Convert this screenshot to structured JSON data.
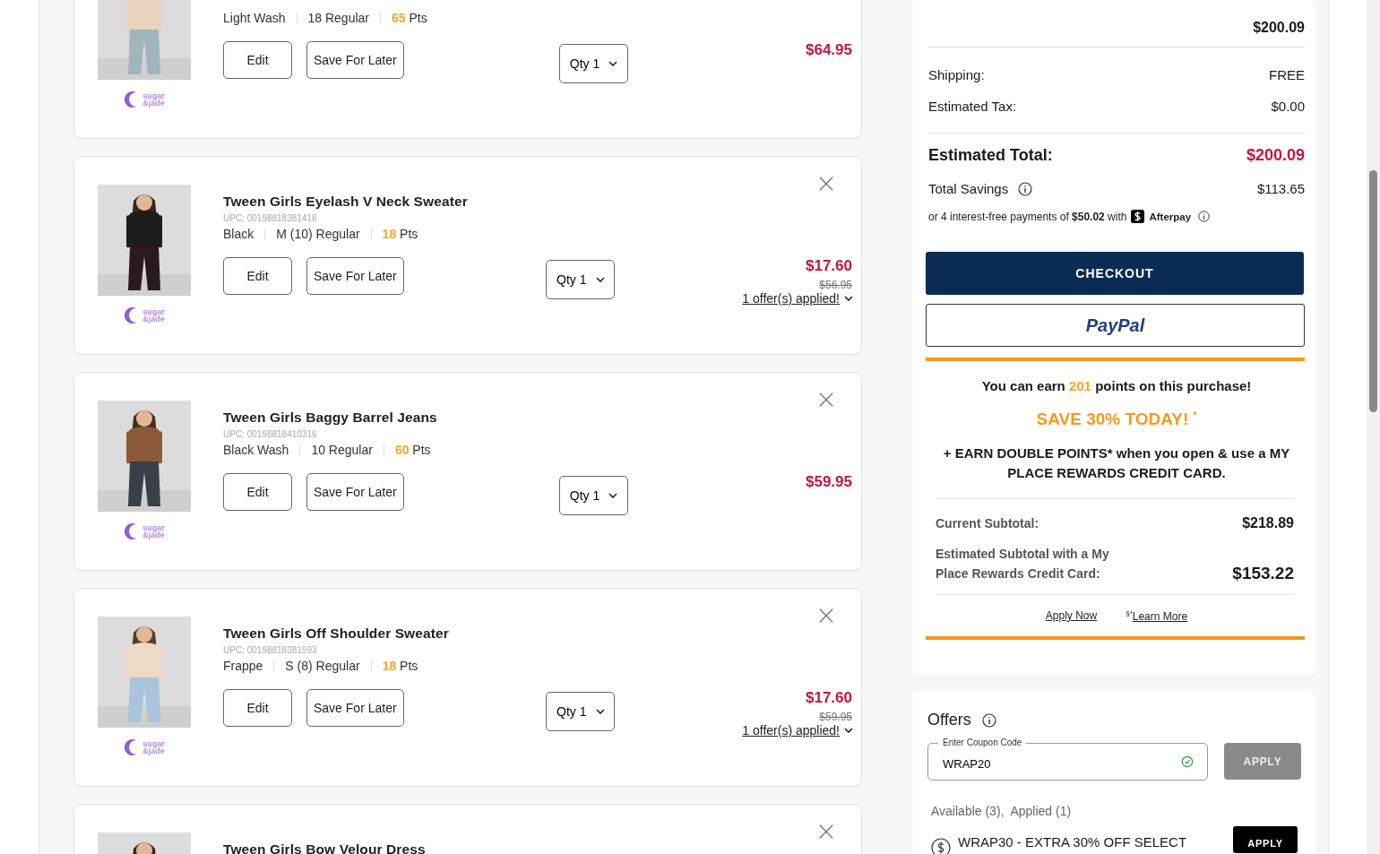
{
  "cart_items": [
    {
      "kind": "picture",
      "brand": [
        "sugar",
        "&jade"
      ],
      "variant": "Light Wash",
      "size": "18 Regular",
      "points": "65",
      "points_unit": "Pts",
      "edit": "Edit",
      "save_later": "Save For Later",
      "qty": "Qty 1",
      "price": "$64.95"
    },
    {
      "kind": "picture",
      "brand": [
        "sugar",
        "&jade"
      ],
      "title": "Tween Girls Eyelash V Neck Sweater",
      "upc": "UPC: 00198818381418",
      "variant": "Black",
      "size": "M (10) Regular",
      "points": "18",
      "points_unit": "Pts",
      "edit": "Edit",
      "save_later": "Save For Later",
      "qty": "Qty 1",
      "price": "$17.60",
      "original_price": "$56.95",
      "offers": "1 offer(s) applied!"
    },
    {
      "kind": "picture",
      "brand": [
        "sugar",
        "&jade"
      ],
      "title": "Tween Girls Baggy Barrel Jeans",
      "upc": "UPC: 00198818410316",
      "variant": "Black Wash",
      "size": "10 Regular",
      "points": "60",
      "points_unit": "Pts",
      "edit": "Edit",
      "save_later": "Save For Later",
      "qty": "Qty 1",
      "price": "$59.95"
    },
    {
      "kind": "picture",
      "brand": [
        "sugar",
        "&jade"
      ],
      "title": "Tween Girls Off Shoulder Sweater",
      "upc": "UPC: 00198818381593",
      "variant": "Frappe",
      "size": "S (8) Regular",
      "points": "18",
      "points_unit": "Pts",
      "edit": "Edit",
      "save_later": "Save For Later",
      "qty": "Qty 1",
      "price": "$17.60",
      "original_price": "$59.95",
      "offers": "1 offer(s) applied!"
    },
    {
      "kind": "picture",
      "title": "Tween Girls Bow Velour Dress"
    }
  ],
  "summary": {
    "subtotal": "$200.09",
    "shipping_label": "Shipping:",
    "shipping": "FREE",
    "tax_label": "Estimated Tax:",
    "tax": "$0.00",
    "total_label": "Estimated Total:",
    "total": "$200.09",
    "savings_label": "Total Savings",
    "savings": "$113.65",
    "afterpay_text": "or 4 interest-free payments of **$50.02** with",
    "afterpay_brand": "Afterpay",
    "checkout": "CHECKOUT",
    "paypal": "PayPal"
  },
  "rewards": {
    "earn_prefix": "You can earn",
    "earn_points": "201",
    "earn_suffix": "points on this purchase!",
    "promo": "SAVE 30% TODAY!",
    "promo_mark": "*",
    "double_points": "+ EARN DOUBLE POINTS* when you open & use a MY PLACE REWARDS CREDIT CARD.",
    "current_label": "Current Subtotal:",
    "current": "$218.89",
    "estimated_label": "Estimated Subtotal with a My Place Rewards Credit Card:",
    "estimated": "$153.22",
    "apply_now": "Apply Now",
    "learn_mark": "§*",
    "learn_more": "Learn More"
  },
  "offers": {
    "title": "Offers",
    "coupon_label": "Enter Coupon Code",
    "coupon_value": "WRAP20",
    "coupon_valid": true,
    "apply": "APPLY",
    "apply_disabled": true,
    "counts": "Available (3),  Applied (1)",
    "items": [
      {
        "text": "WRAP30 - EXTRA 30% OFF SELECT",
        "apply": "APPLY"
      }
    ]
  }
}
